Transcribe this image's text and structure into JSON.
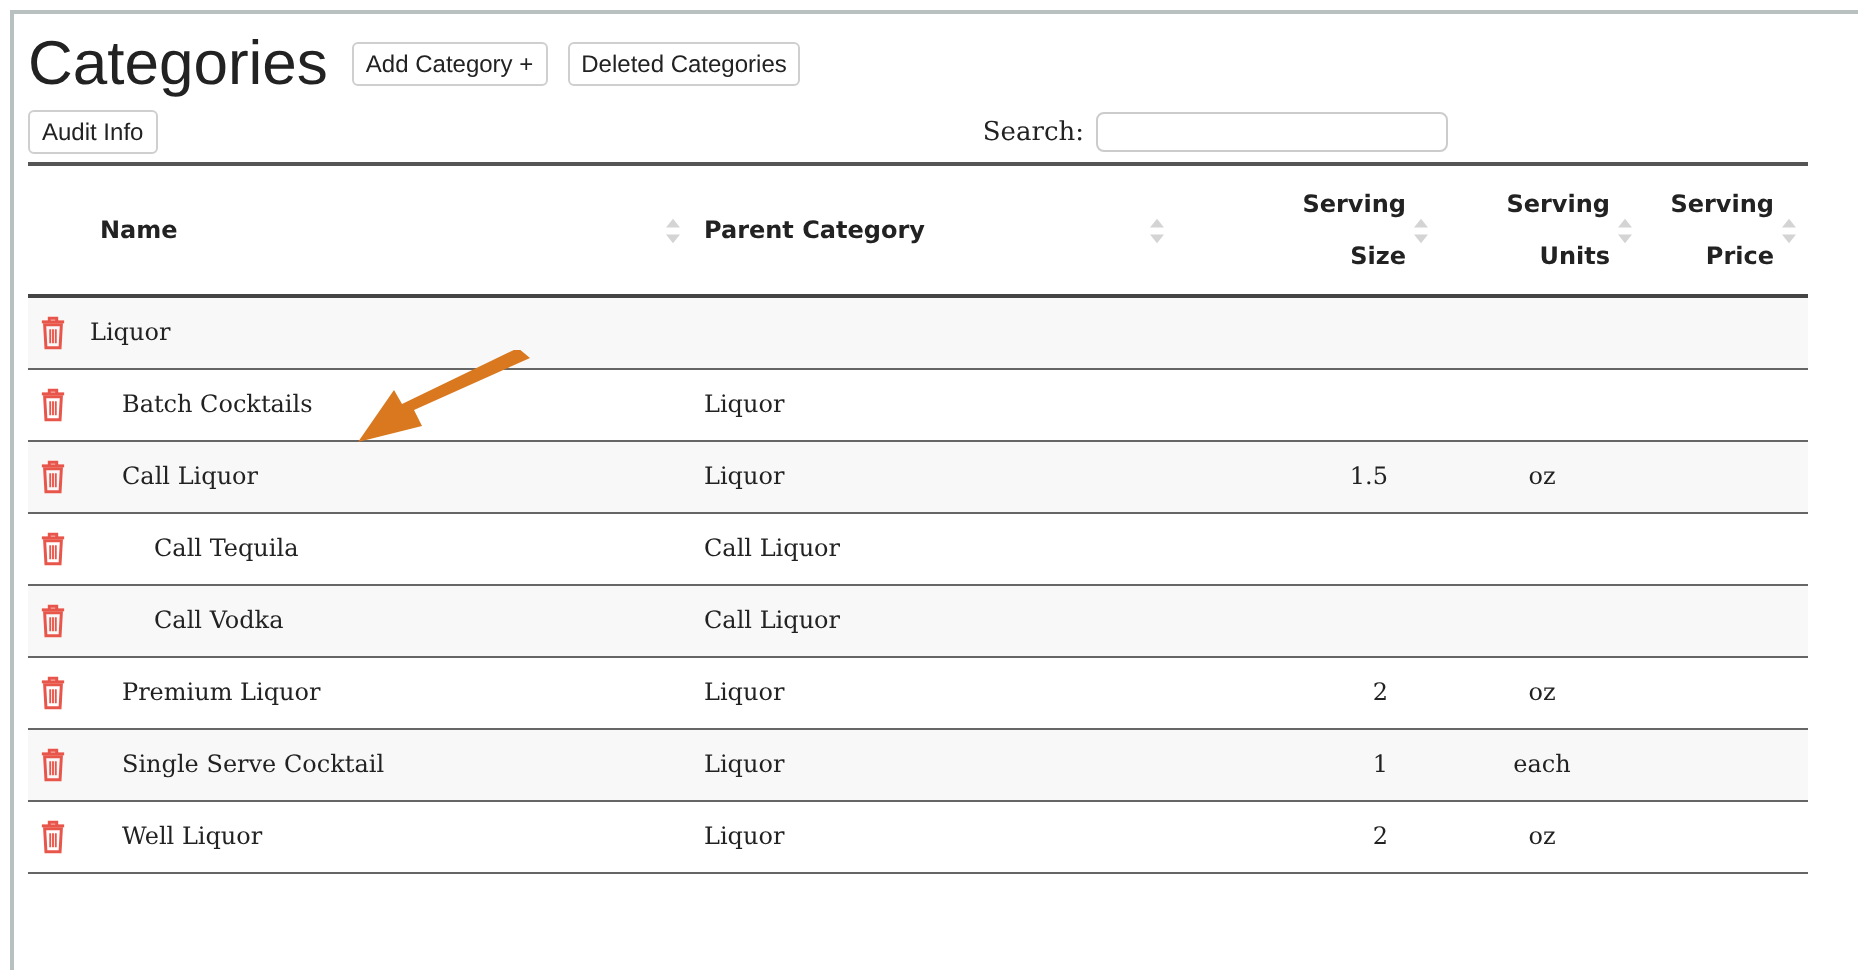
{
  "page": {
    "title": "Categories"
  },
  "header_buttons": [
    "Add Category +",
    "Deleted Categories"
  ],
  "toolbar": {
    "audit_button": "Audit Info",
    "search_label": "Search:"
  },
  "table": {
    "columns": [
      "Name",
      "Parent Category",
      "Serving Size",
      "Serving Units",
      "Serving Price"
    ],
    "rows": [
      {
        "name": "Liquor",
        "children": [
          {
            "name": "Batch Cocktails",
            "parent": "Liquor"
          },
          {
            "name": "Call Liquor",
            "parent": "Liquor",
            "size": "1.5",
            "units": "oz",
            "children": [
              {
                "name": "Call Tequila",
                "parent": "Call Liquor"
              },
              {
                "name": "Call Vodka",
                "parent": "Call Liquor"
              }
            ]
          },
          {
            "name": "Premium Liquor",
            "parent": "Liquor",
            "size": "2",
            "units": "oz"
          },
          {
            "name": "Single Serve Cocktail",
            "parent": "Liquor",
            "size": "1",
            "units": "each"
          },
          {
            "name": "Well Liquor",
            "parent": "Liquor",
            "size": "2",
            "units": "oz"
          }
        ]
      }
    ]
  }
}
